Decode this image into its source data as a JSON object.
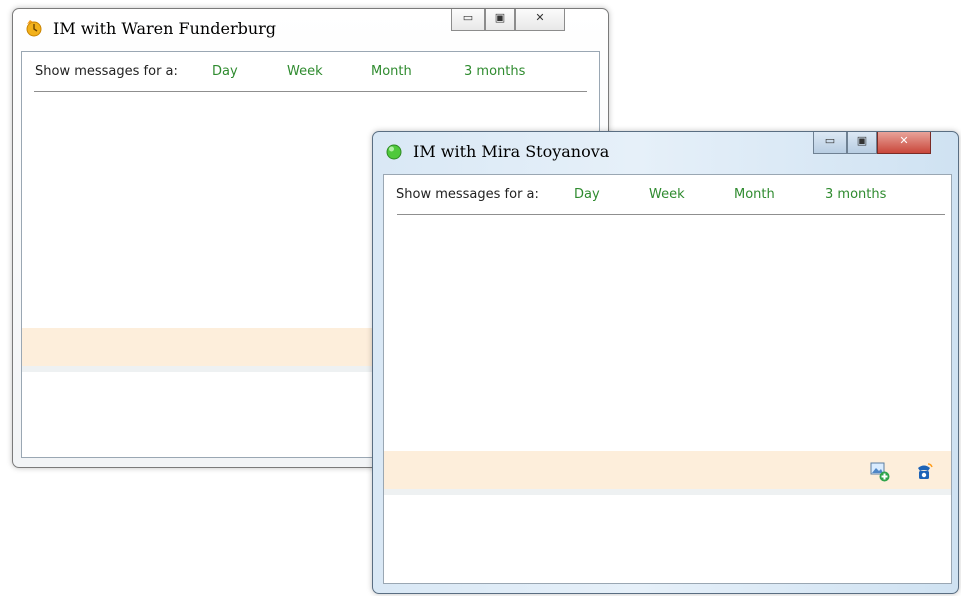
{
  "windows": [
    {
      "title": "IM with Waren Funderburg",
      "status_icon": "away-clock-icon",
      "controls": {
        "minimize": "minimize-button",
        "maximize": "maximize-button",
        "close": "close-button"
      },
      "filter_label": "Show messages for a:",
      "filters": [
        "Day",
        "Week",
        "Month",
        "3 months"
      ]
    },
    {
      "title": "IM with Mira Stoyanova",
      "status_icon": "online-green-dot-icon",
      "controls": {
        "minimize": "minimize-button",
        "maximize": "maximize-button",
        "close": "close-button"
      },
      "filter_label": "Show messages for a:",
      "filters": [
        "Day",
        "Week",
        "Month",
        "3 months"
      ],
      "toolbar_icons": [
        "send-picture-icon",
        "phone-call-icon"
      ]
    }
  ],
  "colors": {
    "link": "#2f8b2f",
    "compose_band": "#fdeedb",
    "active_frame": "#d9e8f5"
  }
}
